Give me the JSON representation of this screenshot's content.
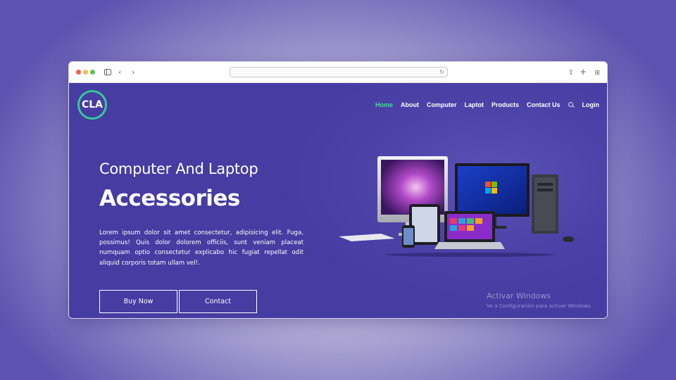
{
  "browser": {
    "url": "",
    "icons": [
      "sidebar-icon",
      "back-arrow-icon",
      "forward-arrow-icon",
      "reload-icon",
      "share-icon",
      "new-tab-icon",
      "tab-overview-icon"
    ]
  },
  "site": {
    "logo_text": "CLA",
    "nav": [
      {
        "label": "Home",
        "active": true
      },
      {
        "label": "About"
      },
      {
        "label": "Computer"
      },
      {
        "label": "Laptot"
      },
      {
        "label": "Products"
      },
      {
        "label": "Contact Us"
      },
      {
        "label": "Login"
      }
    ],
    "hero": {
      "subtitle": "Computer And Laptop",
      "title": "Accessories",
      "description": "Lorem ipsum dolor sit amet consectetur, adipisicing elit. Fuga, possimus! Quis dolor dolorem officiis, sunt veniam placeat numquam optio consectetur explicabo hic fugiat repellat odit aliquid corporis totam ullam vel!.",
      "buy_label": "Buy Now",
      "contact_label": "Contact"
    },
    "watermark": {
      "line1": "Activar Windows",
      "line2": "Ve a Configuración para activar Windows."
    },
    "colors": {
      "accent": "#4fd3a4",
      "background": "#4b41a6",
      "logo_ring": "#37c79a"
    }
  }
}
